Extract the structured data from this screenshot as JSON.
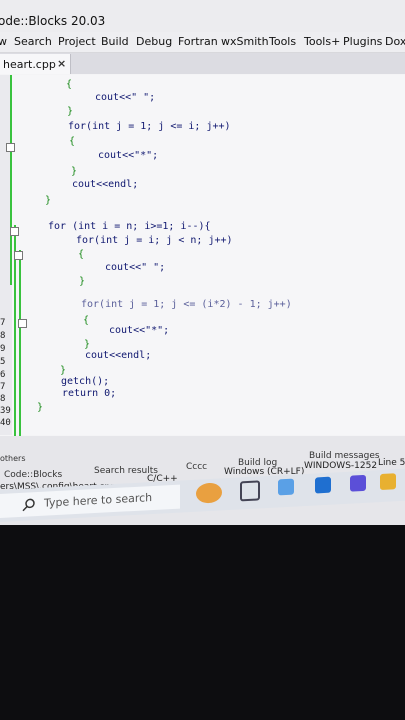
{
  "window": {
    "title": "ode::Blocks 20.03"
  },
  "menu": [
    "w",
    "Search",
    "Project",
    "Build",
    "Debug",
    "Fortran",
    "wxSmith",
    "Tools",
    "Tools+",
    "Plugins",
    "Doxy"
  ],
  "tab": {
    "label": "heart.cpp",
    "close": "×"
  },
  "line_numbers": [
    "5",
    "6",
    "7",
    "8",
    "9",
    "0",
    "1",
    "2",
    "3",
    "4",
    "5",
    "6",
    "7",
    "8",
    "39",
    "40"
  ],
  "code": [
    "{",
    "cout<<\" \";",
    "}",
    "for(int j = 1; j <= i; j++)",
    "{",
    "cout<<\"*\";",
    "}",
    "cout<<endl;",
    "}",
    "for (int i = n; i>=1; i--){",
    "for(int j = i; j < n; j++)",
    "{",
    "cout<<\" \";",
    "}",
    "for(int j = 1; j <= (i*2) - 1; j++)",
    "{",
    "cout<<\"*\";",
    "}",
    "cout<<endl;",
    "}",
    "getch();",
    "return 0;",
    "}"
  ],
  "logs": {
    "others": "others",
    "tabs": [
      "Code::Blocks",
      "Search results",
      "Cccc",
      "Build log",
      "Build messages"
    ],
    "path": "ers\\MSS\\.config\\heart.cpp",
    "language": "C/C++",
    "line_endings": "Windows (CR+LF)",
    "encoding": "WINDOWS-1252",
    "position": "Line 5"
  },
  "taskbar": {
    "search_placeholder": "Type here to search"
  }
}
